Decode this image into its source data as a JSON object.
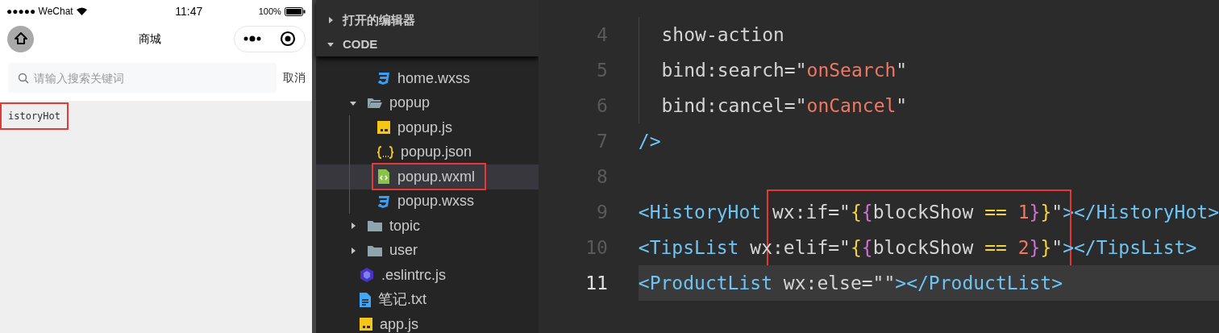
{
  "phone": {
    "status_bar": {
      "carrier": "●●●●● WeChat",
      "time": "11:47",
      "battery": "100%"
    },
    "nav_bar": {
      "title": "商城"
    },
    "search": {
      "placeholder": "请输入搜索关键词",
      "cancel": "取消"
    },
    "content": {
      "text": "istoryHot",
      "annotated": true
    }
  },
  "explorer": {
    "sections": [
      {
        "label": "打开的编辑器",
        "expanded": false
      },
      {
        "label": "CODE",
        "expanded": true
      }
    ],
    "scrolled_children": [
      {
        "kind": "css",
        "label": "home.wxss",
        "selected": false,
        "annotated": false
      }
    ],
    "tree": [
      {
        "kind": "folder",
        "label": "popup",
        "expanded": true,
        "selected": false,
        "annotated": false,
        "children": [
          {
            "kind": "js",
            "label": "popup.js",
            "selected": false,
            "annotated": false
          },
          {
            "kind": "json",
            "label": "popup.json",
            "selected": false,
            "annotated": false
          },
          {
            "kind": "wxml",
            "label": "popup.wxml",
            "selected": true,
            "annotated": true
          },
          {
            "kind": "css",
            "label": "popup.wxss",
            "selected": false,
            "annotated": false
          }
        ]
      },
      {
        "kind": "folder",
        "label": "topic",
        "expanded": false,
        "selected": false,
        "annotated": false
      },
      {
        "kind": "folder",
        "label": "user",
        "expanded": false,
        "selected": false,
        "annotated": false
      },
      {
        "kind": "eslint",
        "label": ".eslintrc.js",
        "selected": false,
        "annotated": false
      },
      {
        "kind": "txt",
        "label": "笔记.txt",
        "selected": false,
        "annotated": false
      },
      {
        "kind": "js",
        "label": "app.js",
        "selected": false,
        "annotated": false
      }
    ]
  },
  "editor": {
    "annotated": true,
    "lines": [
      {
        "number": "4",
        "current": false,
        "indented": true,
        "tokens": [
          {
            "kind": "attr",
            "text": "show-action"
          }
        ]
      },
      {
        "number": "5",
        "current": false,
        "indented": true,
        "tokens": [
          {
            "kind": "attr",
            "text": "bind:search="
          },
          {
            "kind": "attr",
            "text": "\""
          },
          {
            "kind": "string",
            "text": "onSearch"
          },
          {
            "kind": "attr",
            "text": "\""
          }
        ]
      },
      {
        "number": "6",
        "current": false,
        "indented": true,
        "tokens": [
          {
            "kind": "attr",
            "text": "bind:cancel="
          },
          {
            "kind": "attr",
            "text": "\""
          },
          {
            "kind": "string",
            "text": "onCancel"
          },
          {
            "kind": "attr",
            "text": "\""
          }
        ]
      },
      {
        "number": "7",
        "current": false,
        "indented": false,
        "tokens": [
          {
            "kind": "tag",
            "text": "/>"
          }
        ]
      },
      {
        "number": "8",
        "current": false,
        "indented": false
      },
      {
        "number": "9",
        "current": false,
        "indented": false,
        "tokens": [
          {
            "kind": "tag",
            "text": "<HistoryHot"
          },
          {
            "kind": "attr",
            "text": " wx:if=\""
          },
          {
            "kind": "brace_a",
            "text": "{"
          },
          {
            "kind": "brace_b",
            "text": "{"
          },
          {
            "kind": "attr",
            "text": "blockShow "
          },
          {
            "kind": "op",
            "text": "=="
          },
          {
            "kind": "number",
            "text": " 1"
          },
          {
            "kind": "brace_b",
            "text": "}"
          },
          {
            "kind": "brace_a",
            "text": "}"
          },
          {
            "kind": "attr",
            "text": "\""
          },
          {
            "kind": "tag",
            "text": "></HistoryHot>"
          }
        ]
      },
      {
        "number": "10",
        "current": false,
        "indented": false,
        "tokens": [
          {
            "kind": "tag",
            "text": "<TipsList"
          },
          {
            "kind": "attr",
            "text": " wx:elif=\""
          },
          {
            "kind": "brace_a",
            "text": "{"
          },
          {
            "kind": "brace_b",
            "text": "{"
          },
          {
            "kind": "attr",
            "text": "blockShow "
          },
          {
            "kind": "op",
            "text": "=="
          },
          {
            "kind": "number",
            "text": " 2"
          },
          {
            "kind": "brace_b",
            "text": "}"
          },
          {
            "kind": "brace_a",
            "text": "}"
          },
          {
            "kind": "attr",
            "text": "\""
          },
          {
            "kind": "tag",
            "text": "></TipsList>"
          }
        ]
      },
      {
        "number": "11",
        "current": true,
        "indented": false,
        "tokens": [
          {
            "kind": "tag",
            "text": "<ProductList"
          },
          {
            "kind": "attr",
            "text": " wx:else=\"\""
          },
          {
            "kind": "tag",
            "text": "></ProductList>"
          }
        ]
      }
    ]
  }
}
